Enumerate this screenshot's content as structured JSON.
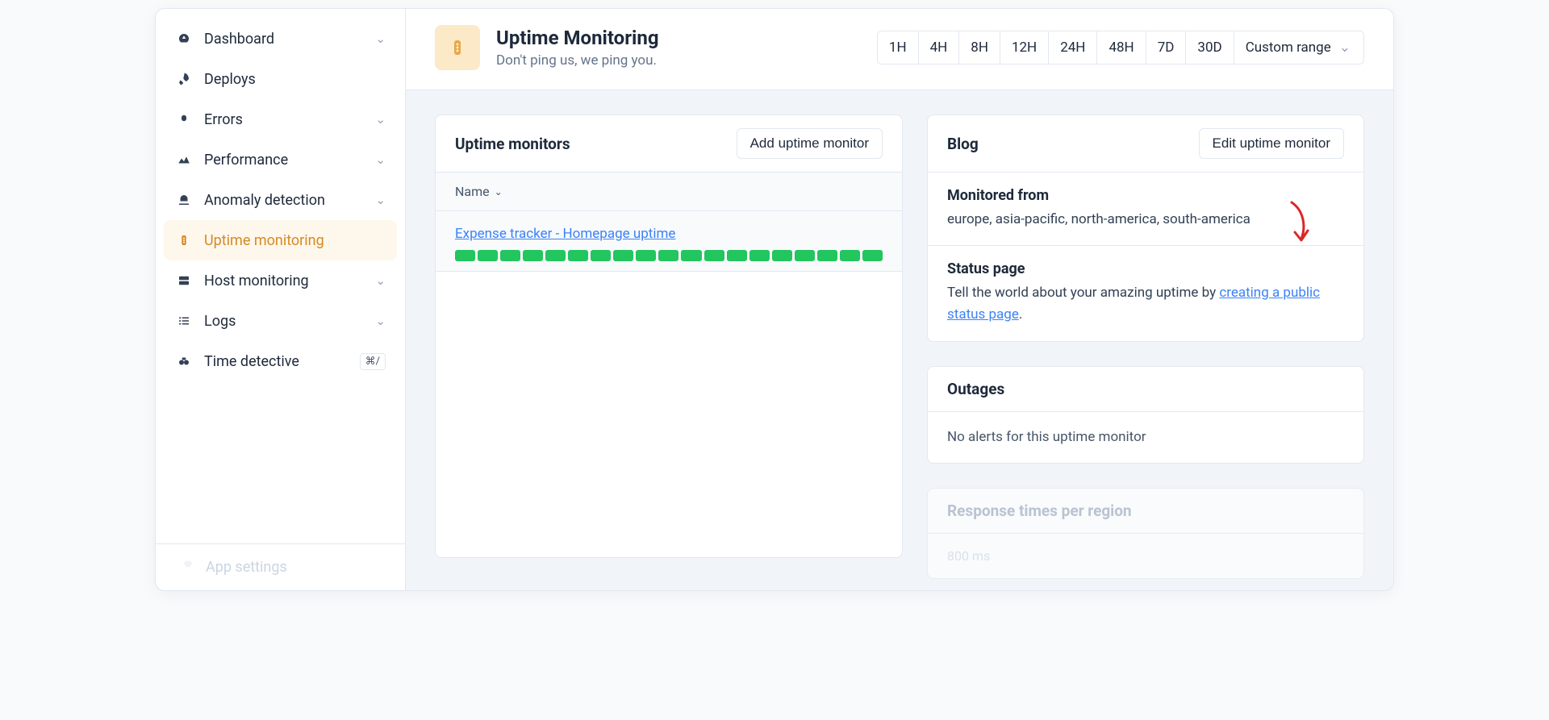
{
  "sidebar": {
    "items": [
      {
        "label": "Dashboard",
        "icon": "gauge",
        "chevron": true
      },
      {
        "label": "Deploys",
        "icon": "rocket",
        "chevron": false
      },
      {
        "label": "Errors",
        "icon": "bug",
        "chevron": true
      },
      {
        "label": "Performance",
        "icon": "speed",
        "chevron": true
      },
      {
        "label": "Anomaly detection",
        "icon": "alarm",
        "chevron": true
      },
      {
        "label": "Uptime monitoring",
        "icon": "traffic",
        "chevron": false,
        "active": true
      },
      {
        "label": "Host monitoring",
        "icon": "server",
        "chevron": true
      },
      {
        "label": "Logs",
        "icon": "lines",
        "chevron": true
      },
      {
        "label": "Time detective",
        "icon": "binoculars",
        "shortcut": "⌘/"
      }
    ],
    "settings_label": "App settings"
  },
  "header": {
    "title": "Uptime Monitoring",
    "subtitle": "Don't ping us, we ping you.",
    "ranges": [
      "1H",
      "4H",
      "8H",
      "12H",
      "24H",
      "48H",
      "7D",
      "30D"
    ],
    "custom_label": "Custom range"
  },
  "monitors_card": {
    "title": "Uptime monitors",
    "add_button": "Add uptime monitor",
    "column": "Name",
    "monitor_name": "Expense tracker - Homepage uptime",
    "bar_count": 19
  },
  "details_card": {
    "title": "Blog",
    "edit_button": "Edit uptime monitor",
    "monitored_from_label": "Monitored from",
    "monitored_from_value": "europe, asia-pacific, north-america, south-america",
    "status_page_label": "Status page",
    "status_page_text": "Tell the world about your amazing uptime by ",
    "status_page_link": "creating a public status page",
    "status_page_period": "."
  },
  "outages_card": {
    "title": "Outages",
    "empty_text": "No alerts for this uptime monitor"
  },
  "response_card": {
    "title": "Response times per region",
    "y_tick": "800 ms"
  }
}
